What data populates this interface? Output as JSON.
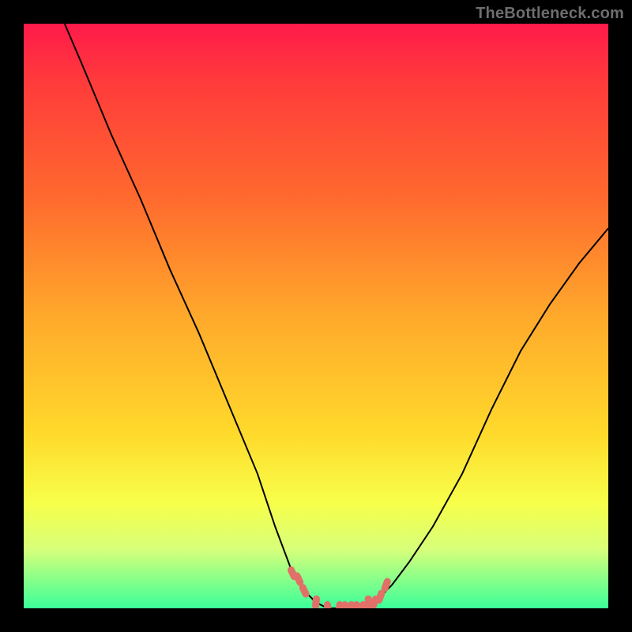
{
  "watermark": {
    "text": "TheBottleneck.com"
  },
  "colors": {
    "background": "#000000",
    "curve": "#000000",
    "marker": "#e07068",
    "gradient_top": "#ff1a4a",
    "gradient_bottom": "#3bff99"
  },
  "chart_data": {
    "type": "line",
    "title": "",
    "xlabel": "",
    "ylabel": "",
    "xlim": [
      0,
      100
    ],
    "ylim": [
      0,
      100
    ],
    "grid": false,
    "legend": false,
    "series": [
      {
        "name": "bottleneck-curve",
        "x": [
          7,
          10,
          15,
          20,
          25,
          30,
          35,
          40,
          43,
          46,
          48,
          50,
          52,
          54,
          56,
          58,
          60,
          63,
          66,
          70,
          75,
          80,
          85,
          90,
          95,
          100
        ],
        "y": [
          100,
          93,
          81,
          70,
          58,
          47,
          35,
          23,
          14,
          6,
          3,
          1,
          0,
          0,
          0,
          0,
          1,
          4,
          8,
          14,
          23,
          34,
          44,
          52,
          59,
          65
        ]
      }
    ],
    "marker_points": {
      "name": "highlighted-range",
      "x": [
        46,
        47,
        48,
        50,
        52,
        54,
        55,
        56,
        57,
        58,
        59,
        60,
        61,
        62
      ],
      "y": [
        6,
        5,
        3,
        1,
        0,
        0,
        0,
        0,
        0,
        0,
        1,
        1,
        2,
        4
      ]
    }
  }
}
